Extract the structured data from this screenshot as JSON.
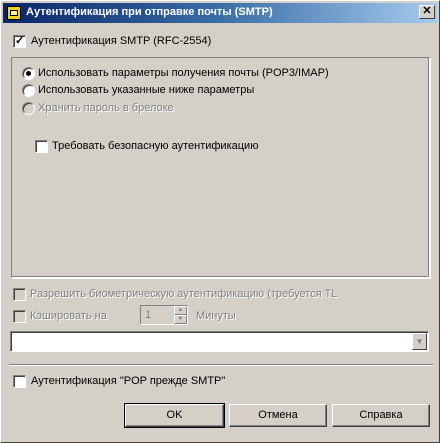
{
  "window": {
    "title": "Аутентификация при отправке почты (SMTP)",
    "close_label": "✕"
  },
  "smtp_auth": {
    "label": "Аутентификация SMTP (RFC-2554)",
    "checked": true
  },
  "options": {
    "use_receive_params": {
      "label": "Использовать параметры получения почты (POP3/IMAP)",
      "selected": true
    },
    "use_below_params": {
      "label": "Использовать указанные ниже параметры",
      "selected": false
    },
    "store_password_keychain": {
      "label": "Хранить пароль в брелоке",
      "enabled": false
    },
    "require_secure_auth": {
      "label": "Требовать безопасную аутентификацию",
      "checked": false
    }
  },
  "biometric": {
    "label": "Разрешить биометрическую аутентификацию (требуется TL",
    "enabled": false
  },
  "cache": {
    "label": "Кэшировать на",
    "value": "1",
    "unit": "Минуты",
    "enabled": false
  },
  "combo": {
    "value": ""
  },
  "pop_before_smtp": {
    "label": "Аутентификация \"POP прежде SMTP\"",
    "checked": false
  },
  "buttons": {
    "ok": "OK",
    "cancel": "Отмена",
    "help": "Справка"
  }
}
